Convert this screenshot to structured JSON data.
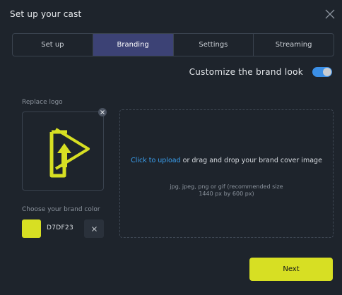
{
  "dialog": {
    "title": "Set up your cast"
  },
  "tabs": [
    {
      "label": "Set up",
      "active": false
    },
    {
      "label": "Branding",
      "active": true
    },
    {
      "label": "Settings",
      "active": false
    },
    {
      "label": "Streaming",
      "active": false
    }
  ],
  "brand": {
    "toggle_label": "Customize the brand look",
    "toggle_on": true
  },
  "logo": {
    "section_label": "Replace logo",
    "icon": "play-arrow-logo",
    "remove_icon": "close-icon"
  },
  "upload": {
    "link_text": "Click to upload",
    "main_text_rest": " or drag and drop your brand cover image",
    "hint": "jpg, jpeg, png or gif (recommended size 1440 px by 600 px)"
  },
  "brand_color": {
    "section_label": "Choose your brand color",
    "hex": "D7DF23",
    "swatch_color": "#D7DF23",
    "clear_icon": "close-icon"
  },
  "footer": {
    "next_label": "Next"
  },
  "colors": {
    "background": "#1e242c",
    "active_tab": "#3c4275",
    "toggle_on": "#3b8fe6",
    "link": "#3aa0f0",
    "accent": "#D7DF23"
  }
}
